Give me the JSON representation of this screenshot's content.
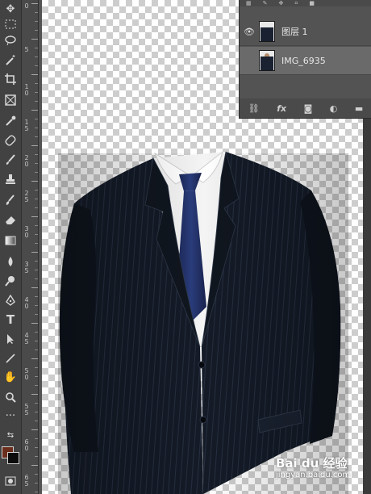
{
  "toolbar": {
    "tools": [
      {
        "name": "move-tool",
        "icon": "move-icon"
      },
      {
        "name": "marquee-tool",
        "icon": "marquee-icon"
      },
      {
        "name": "lasso-tool",
        "icon": "lasso-icon"
      },
      {
        "name": "magic-wand-tool",
        "icon": "magic-wand-icon"
      },
      {
        "name": "crop-tool",
        "icon": "crop-icon"
      },
      {
        "name": "frame-tool",
        "icon": "frame-icon"
      },
      {
        "name": "eyedropper-tool",
        "icon": "eyedropper-icon"
      },
      {
        "name": "healing-brush-tool",
        "icon": "bandage-icon"
      },
      {
        "name": "brush-tool",
        "icon": "brush-icon"
      },
      {
        "name": "clone-stamp-tool",
        "icon": "stamp-icon"
      },
      {
        "name": "history-brush-tool",
        "icon": "history-brush-icon"
      },
      {
        "name": "eraser-tool",
        "icon": "eraser-icon"
      },
      {
        "name": "gradient-tool",
        "icon": "gradient-icon"
      },
      {
        "name": "blur-tool",
        "icon": "drop-icon"
      },
      {
        "name": "dodge-tool",
        "icon": "dodge-icon"
      },
      {
        "name": "pen-tool",
        "icon": "pen-icon"
      },
      {
        "name": "type-tool",
        "icon": "type-icon",
        "label": "T"
      },
      {
        "name": "path-selection-tool",
        "icon": "arrow-icon"
      },
      {
        "name": "line-tool",
        "icon": "line-icon"
      },
      {
        "name": "hand-tool",
        "icon": "hand-icon"
      },
      {
        "name": "zoom-tool",
        "icon": "zoom-icon"
      },
      {
        "name": "more-tools",
        "icon": "ellipsis-icon"
      }
    ],
    "foreground_color": "#6b2d1c",
    "background_color": "#0c0c0c"
  },
  "ruler": {
    "labels": [
      "0",
      "5",
      "1 0",
      "1 5",
      "2 0",
      "2 5",
      "3 0",
      "3 5",
      "4 0",
      "4 5",
      "5 0",
      "5 5",
      "6 0",
      "6 5"
    ]
  },
  "layers": [
    {
      "name": "图层 1",
      "visible": true
    },
    {
      "name": "IMG_6935",
      "visible": false,
      "selected": true
    }
  ],
  "layers_toolbar": [
    "link-icon",
    "fx-icon",
    "mask-icon",
    "adjustment-icon",
    "folder-icon"
  ],
  "layers_fx_label": "fx",
  "watermark": {
    "brand": "Bai du 经验",
    "url": "jingyan.baidu.com"
  }
}
